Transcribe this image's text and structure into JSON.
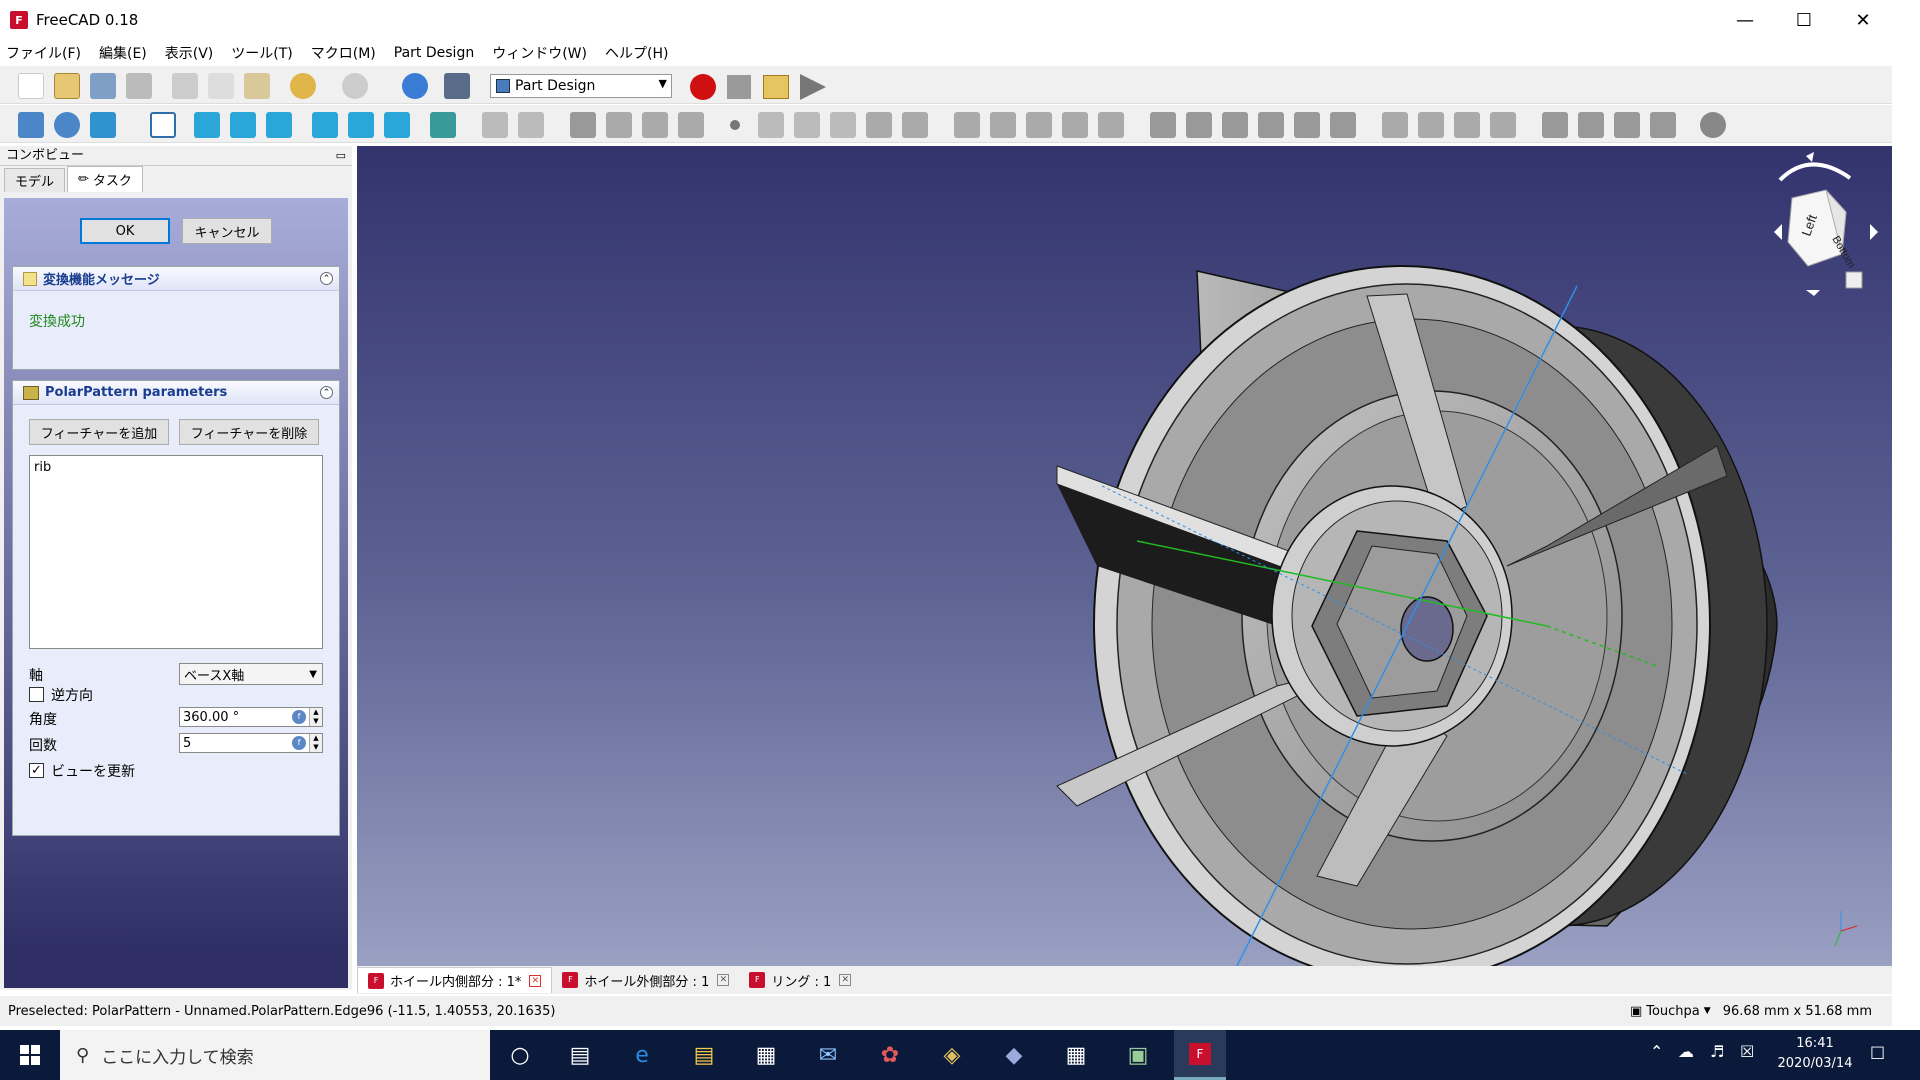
{
  "window": {
    "title": "FreeCAD 0.18",
    "logo_text": "F"
  },
  "menu": [
    "ファイル(F)",
    "編集(E)",
    "表示(V)",
    "ツール(T)",
    "マクロ(M)",
    "Part Design",
    "ウィンドウ(W)",
    "ヘルプ(H)"
  ],
  "toolbar": {
    "workbench": "Part Design"
  },
  "combo": {
    "header": "コンボビュー",
    "tabs": [
      "モデル",
      "タスク"
    ],
    "ok": "OK",
    "cancel": "キャンセル",
    "message_panel": {
      "title": "変換機能メッセージ",
      "text": "変換成功"
    },
    "params_panel": {
      "title": "PolarPattern parameters",
      "add_feature": "フィーチャーを追加",
      "remove_feature": "フィーチャーを削除",
      "features": [
        "rib"
      ],
      "axis_label": "軸",
      "axis_value": "ベースX軸",
      "reverse_label": "逆方向",
      "reverse_checked": false,
      "angle_label": "角度",
      "angle_value": "360.00 °",
      "count_label": "回数",
      "count_value": "5",
      "update_label": "ビューを更新",
      "update_checked": true
    }
  },
  "navcube": {
    "left": "Left",
    "bottom": "Bottom"
  },
  "doc_tabs": [
    {
      "label": "ホイール内側部分 : 1*",
      "active": true
    },
    {
      "label": "ホイール外側部分 : 1",
      "active": false
    },
    {
      "label": "リング : 1",
      "active": false
    }
  ],
  "status": {
    "preselected": "Preselected: PolarPattern - Unnamed.PolarPattern.Edge96 (-11.5, 1.40553, 20.1635)",
    "nav_style": "Touchpa",
    "dimensions": "96.68 mm x 51.68 mm"
  },
  "taskbar": {
    "search_placeholder": "ここに入力して検索",
    "time": "16:41",
    "date": "2020/03/14"
  }
}
